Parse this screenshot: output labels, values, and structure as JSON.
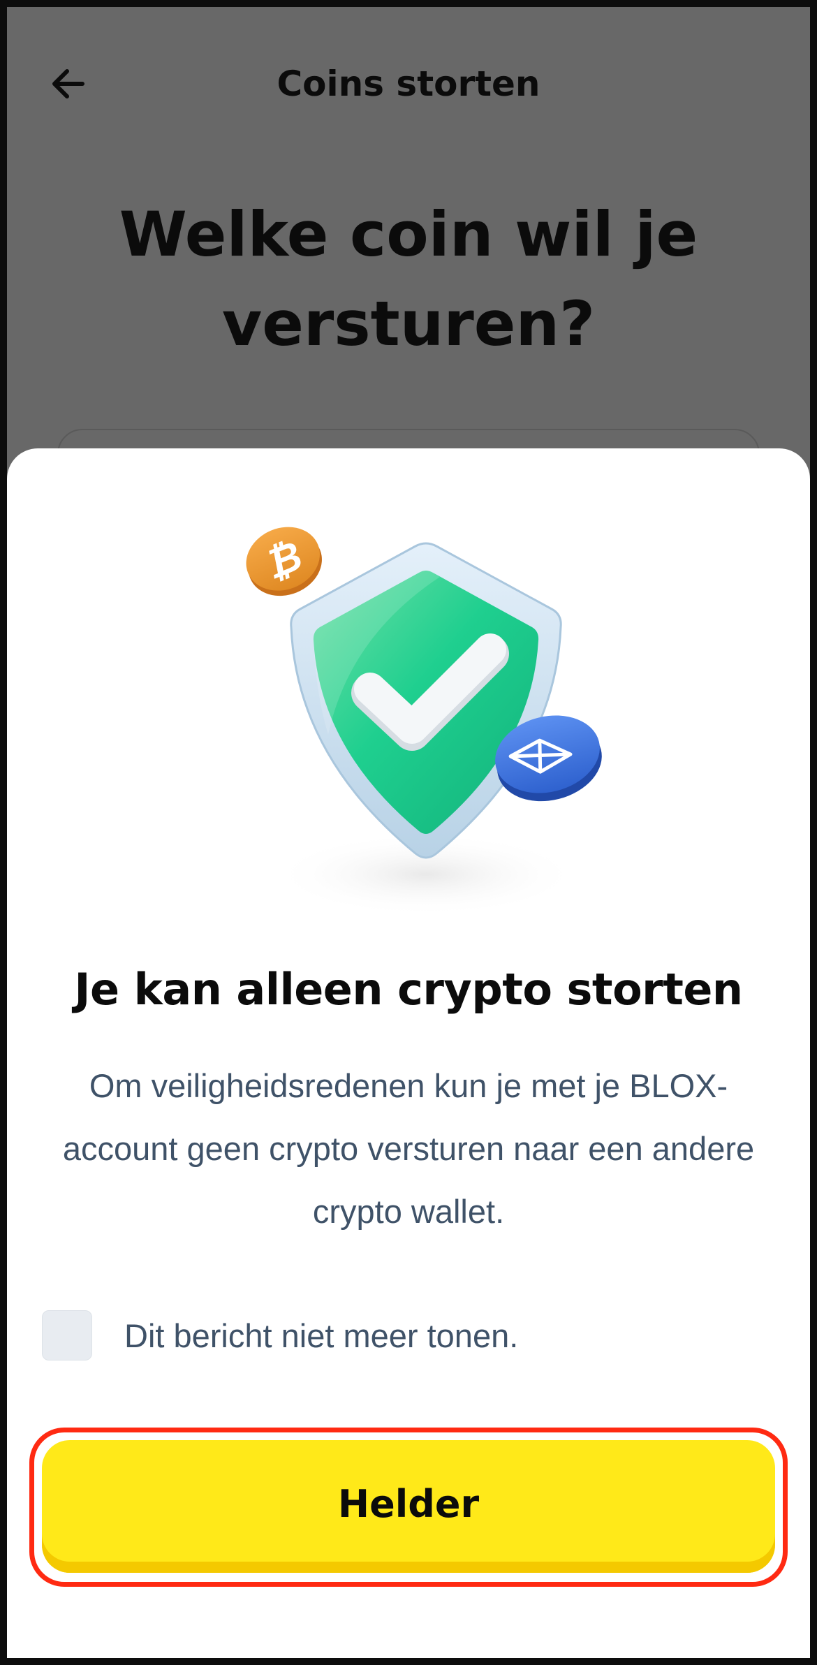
{
  "background": {
    "header_title": "Coins storten",
    "heading": "Welke coin wil je versturen?"
  },
  "icons": {
    "back": "arrow-left-icon",
    "illustration": "shield-checkmark-icon",
    "bitcoin": "bitcoin-coin-icon",
    "ethereum": "ethereum-coin-icon"
  },
  "sheet": {
    "title": "Je kan alleen crypto storten",
    "body": "Om veiligheidsredenen kun je met je BLOX-account geen crypto versturen naar een andere crypto wallet.",
    "checkbox_label": "Dit bericht niet meer tonen.",
    "checkbox_checked": false,
    "button_label": "Helder"
  },
  "colors": {
    "accent_yellow": "#ffe919",
    "highlight_red": "#ff2a12",
    "shield_green": "#1fcf8f",
    "text_slate": "#3f5268"
  }
}
